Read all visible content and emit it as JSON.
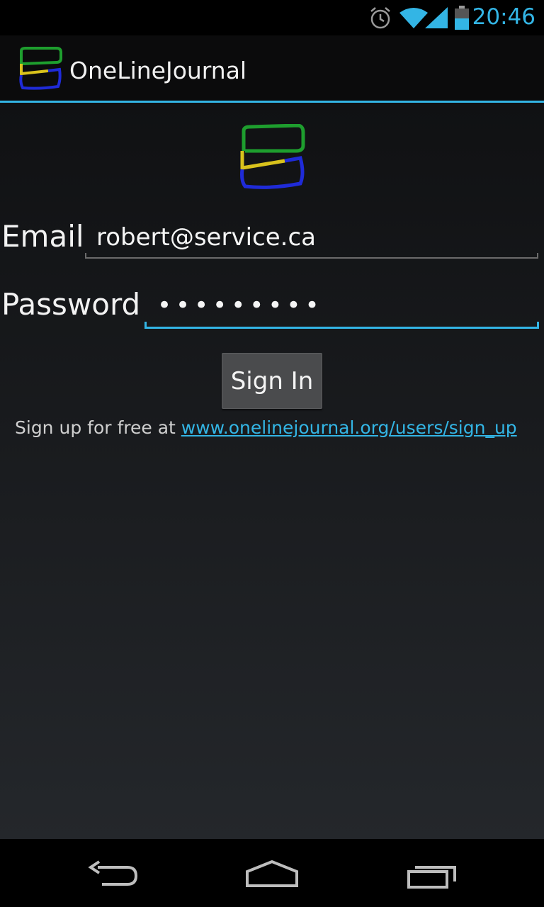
{
  "status_bar": {
    "time": "20:46",
    "icons": [
      "alarm-icon",
      "wifi-icon",
      "signal-icon",
      "battery-icon"
    ]
  },
  "action_bar": {
    "title": "OneLineJournal",
    "icon": "app-logo-icon"
  },
  "form": {
    "email_label": "Email",
    "email_value": "robert@service.ca",
    "password_label": "Password",
    "password_value": "•••••••••",
    "signin_label": "Sign In",
    "signup_prefix": "Sign up for free at ",
    "signup_link": "www.onelinejournal.org/users/sign_up"
  },
  "nav_bar": {
    "icons": [
      "back-icon",
      "home-icon",
      "recent-apps-icon"
    ]
  },
  "colors": {
    "accent": "#33b5e5",
    "logo_green": "#1e9e2e",
    "logo_yellow": "#d9c21c",
    "logo_blue": "#1f2bd8"
  }
}
